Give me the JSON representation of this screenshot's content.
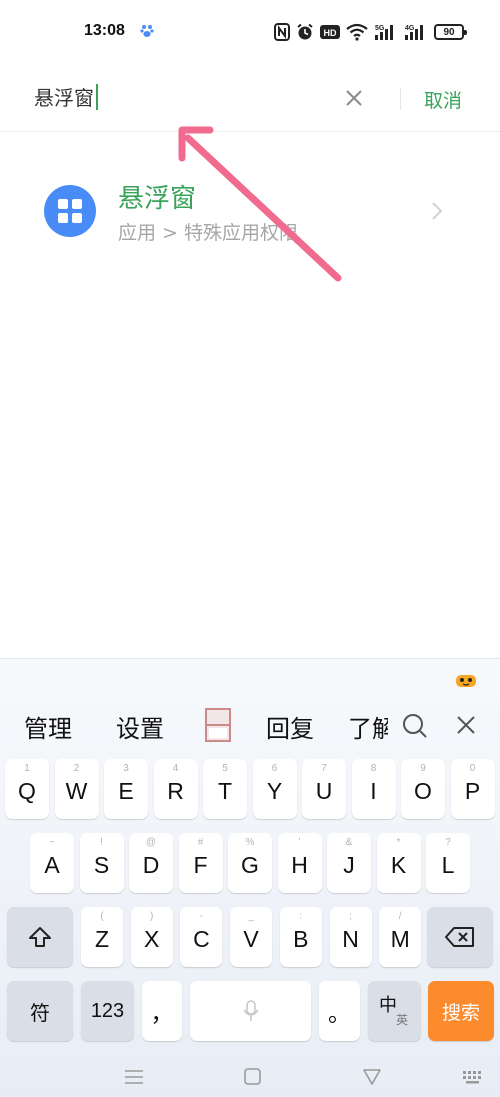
{
  "status_bar": {
    "time": "13:08",
    "battery": "90",
    "icons": [
      "paw-icon",
      "nfc-icon",
      "alarm-icon",
      "hd-icon",
      "wifi-icon",
      "signal-5g-icon",
      "signal-4g-icon",
      "battery-icon"
    ]
  },
  "search": {
    "query": "悬浮窗",
    "cancel_label": "取消"
  },
  "results": [
    {
      "title": "悬浮窗",
      "subtitle": "应用 > 特殊应用权限",
      "icon": "grid-apps-icon"
    }
  ],
  "keyboard": {
    "candidates": [
      "管理",
      "设置",
      "回复",
      "了解"
    ],
    "row1": [
      {
        "k": "Q",
        "h": "1"
      },
      {
        "k": "W",
        "h": "2"
      },
      {
        "k": "E",
        "h": "3"
      },
      {
        "k": "R",
        "h": "4"
      },
      {
        "k": "T",
        "h": "5"
      },
      {
        "k": "Y",
        "h": "6"
      },
      {
        "k": "U",
        "h": "7"
      },
      {
        "k": "I",
        "h": "8"
      },
      {
        "k": "O",
        "h": "9"
      },
      {
        "k": "P",
        "h": "0"
      }
    ],
    "row2": [
      {
        "k": "A",
        "h": "~"
      },
      {
        "k": "S",
        "h": "!"
      },
      {
        "k": "D",
        "h": "@"
      },
      {
        "k": "F",
        "h": "#"
      },
      {
        "k": "G",
        "h": "%"
      },
      {
        "k": "H",
        "h": "'"
      },
      {
        "k": "J",
        "h": "&"
      },
      {
        "k": "K",
        "h": "*"
      },
      {
        "k": "L",
        "h": "?"
      }
    ],
    "row3": [
      {
        "k": "Z",
        "h": "("
      },
      {
        "k": "X",
        "h": ")"
      },
      {
        "k": "C",
        "h": "-"
      },
      {
        "k": "V",
        "h": "_"
      },
      {
        "k": "B",
        "h": ":"
      },
      {
        "k": "N",
        "h": ";"
      },
      {
        "k": "M",
        "h": "/"
      }
    ],
    "symbol_label": "符",
    "num_label": "123",
    "comma_label": "，",
    "period_label": "。",
    "lang_main": "中",
    "lang_sub": "英",
    "search_label": "搜索"
  },
  "colors": {
    "accent_green": "#3aa35a",
    "icon_blue": "#4a8cf7",
    "search_key_orange": "#fb8b2c",
    "annotation_pink": "#f06b8e"
  }
}
